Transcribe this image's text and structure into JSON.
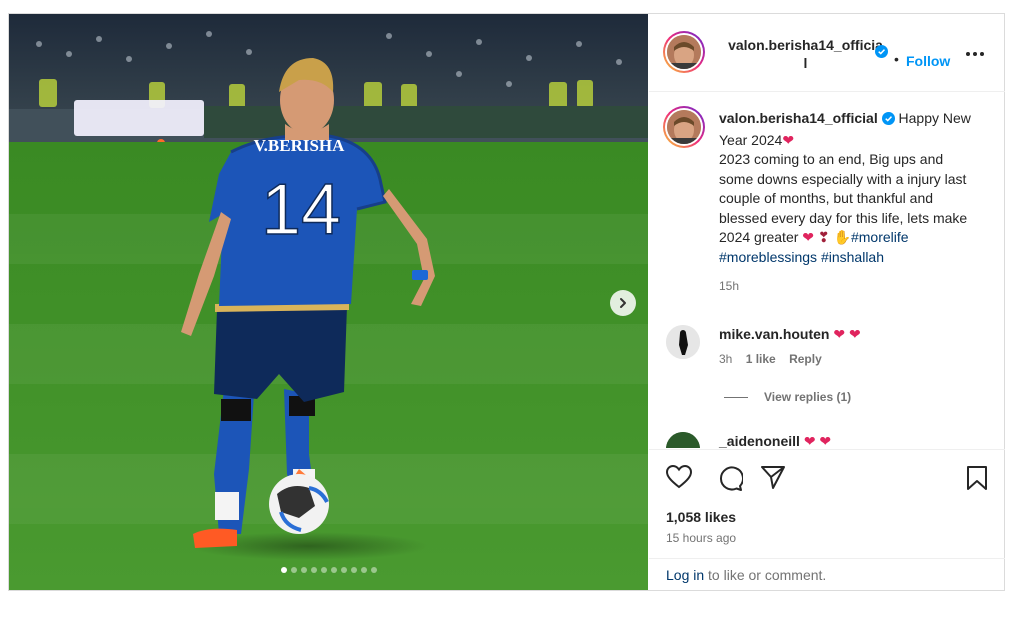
{
  "post": {
    "username": "valon.berisha14_official",
    "header_username": "valon.berisha14_officia",
    "header_username_wrap": "l",
    "follow_label": "Follow",
    "more_icon": "more-horizontal-icon",
    "media": {
      "jersey_name": "V.BERISHA",
      "jersey_number": "14",
      "carousel_count": 10,
      "carousel_active": 0
    },
    "caption": {
      "text_lead": "Happy New Year 2024",
      "text_body": "2023 coming to an end, Big ups and some downs especially with a injury last couple of months, but thankful and blessed every day for this life, lets make 2024 greater",
      "hashtags": [
        "#morelife",
        "#moreblessings",
        "#inshallah"
      ],
      "time": "15h"
    },
    "comments": [
      {
        "username": "mike.van.houten",
        "time": "3h",
        "likes": "1 like",
        "reply_label": "Reply",
        "view_replies": "View replies (1)"
      },
      {
        "username": "_aidenoneill"
      }
    ],
    "likes": "1,058 likes",
    "posted": "15 hours ago",
    "login_link": "Log in",
    "login_suffix": "to like or comment."
  },
  "colors": {
    "accent": "#0095f6",
    "hashtag": "#00376b",
    "heart": "#e0245e",
    "jersey": "#1c55b8",
    "pitch": "#3f8a2a"
  }
}
